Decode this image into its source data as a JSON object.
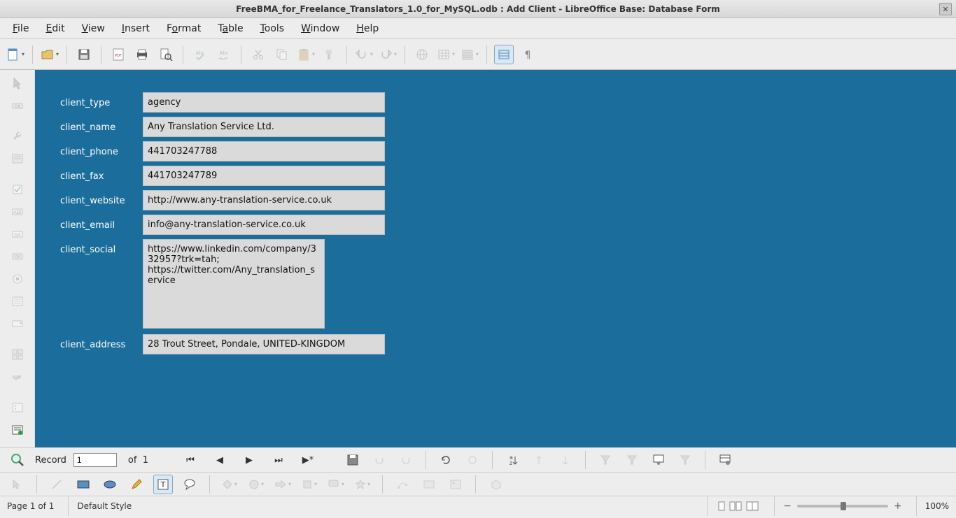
{
  "window": {
    "title": "FreeBMA_for_Freelance_Translators_1.0_for_MySQL.odb : Add Client - LibreOffice Base: Database Form"
  },
  "menu": {
    "file": "File",
    "edit": "Edit",
    "view": "View",
    "insert": "Insert",
    "format": "Format",
    "table": "Table",
    "tools": "Tools",
    "window": "Window",
    "help": "Help"
  },
  "form": {
    "labels": {
      "client_type": "client_type",
      "client_name": "client_name",
      "client_phone": "client_phone",
      "client_fax": "client_fax",
      "client_website": "client_website",
      "client_email": "client_email",
      "client_social": "client_social",
      "client_address": "client_address"
    },
    "values": {
      "client_type": "agency",
      "client_name": "Any Translation Service Ltd.",
      "client_phone": "441703247788",
      "client_fax": "441703247789",
      "client_website": "http://www.any-translation-service.co.uk",
      "client_email": "info@any-translation-service.co.uk",
      "client_social": "https://www.linkedin.com/company/332957?trk=tah;\nhttps://twitter.com/Any_translation_service",
      "client_address": "28 Trout Street, Pondale, UNITED-KINGDOM"
    }
  },
  "record_nav": {
    "label": "Record",
    "current": "1",
    "of_label": "of",
    "total": "1"
  },
  "status": {
    "page": "Page 1 of 1",
    "style": "Default Style",
    "zoom": "100%"
  }
}
